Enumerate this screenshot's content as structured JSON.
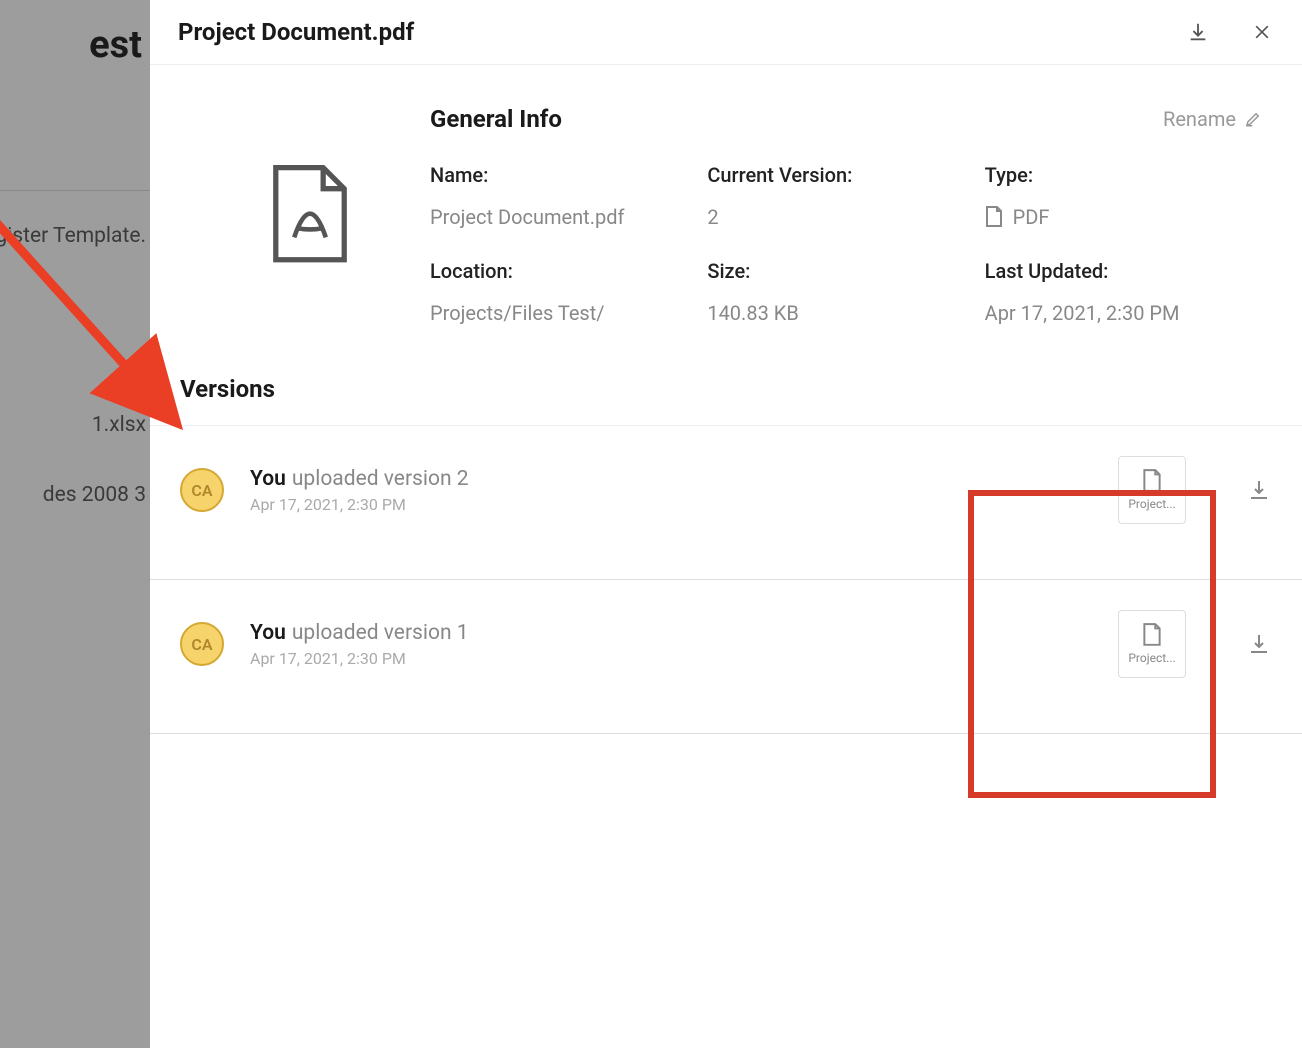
{
  "backdrop": {
    "header_fragment": "est",
    "rows": [
      "egister Template.",
      "1.xlsx",
      "des 2008 3"
    ]
  },
  "panel": {
    "title": "Project Document.pdf",
    "info": {
      "heading": "General Info",
      "rename_label": "Rename",
      "fields": {
        "name": {
          "label": "Name:",
          "value": "Project Document.pdf"
        },
        "current_version": {
          "label": "Current Version:",
          "value": "2"
        },
        "type": {
          "label": "Type:",
          "value": "PDF"
        },
        "location": {
          "label": "Location:",
          "value": "Projects/Files Test/"
        },
        "size": {
          "label": "Size:",
          "value": "140.83 KB"
        },
        "last_updated": {
          "label": "Last Updated:",
          "value": "Apr 17, 2021, 2:30 PM"
        }
      }
    },
    "versions": {
      "heading": "Versions",
      "items": [
        {
          "avatar": "CA",
          "actor": "You",
          "action": "uploaded version 2",
          "timestamp": "Apr 17, 2021, 2:30 PM",
          "file_label": "Project..."
        },
        {
          "avatar": "CA",
          "actor": "You",
          "action": "uploaded version 1",
          "timestamp": "Apr 17, 2021, 2:30 PM",
          "file_label": "Project..."
        }
      ]
    }
  },
  "annotation": {
    "highlight_color": "#d63b2a",
    "arrow_color": "#ea3e25"
  }
}
